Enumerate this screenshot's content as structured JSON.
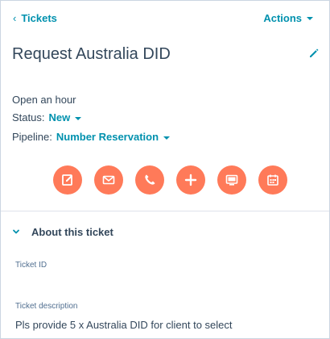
{
  "nav": {
    "back_label": "Tickets",
    "actions_label": "Actions"
  },
  "ticket": {
    "title": "Request Australia DID",
    "open_time": "Open an hour",
    "status_label": "Status:",
    "status_value": "New",
    "pipeline_label": "Pipeline:",
    "pipeline_value": "Number Reservation"
  },
  "action_buttons": [
    {
      "icon": "note-icon"
    },
    {
      "icon": "email-icon"
    },
    {
      "icon": "phone-icon"
    },
    {
      "icon": "plus-icon"
    },
    {
      "icon": "log-activity-icon"
    },
    {
      "icon": "meeting-calendar-icon"
    }
  ],
  "about_section": {
    "title": "About this ticket",
    "ticket_id_label": "Ticket ID",
    "ticket_description_label": "Ticket description",
    "ticket_description_value": "Pls provide 5 x Australia DID for client to select"
  },
  "colors": {
    "link": "#0091ae",
    "action_button": "#ff7a59",
    "text": "#33475b"
  }
}
